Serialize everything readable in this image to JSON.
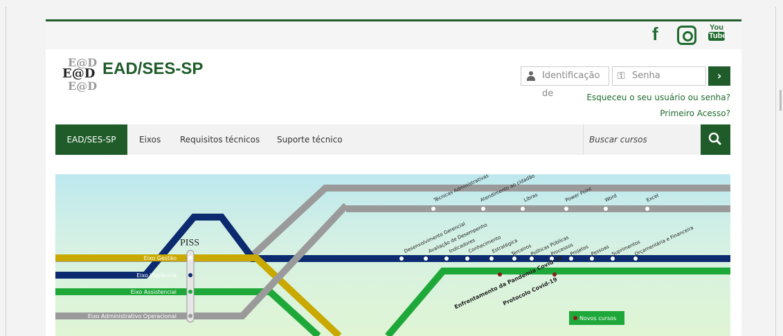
{
  "social": {
    "facebook": "f",
    "youtube_top": "You",
    "youtube_bottom": "Tube"
  },
  "header": {
    "logo_text": "EAD/SES-SP",
    "logo_mark": "E@D",
    "user_placeholder": "Identificação de",
    "pass_placeholder": "Senha",
    "login_button": "›",
    "forgot_link": "Esqueceu o seu usuário ou senha?",
    "first_access_link": "Primeiro Acesso?"
  },
  "nav": {
    "items": [
      "EAD/SES-SP",
      "Eixos",
      "Requisitos técnicos",
      "Suporte técnico"
    ],
    "search_placeholder": "Buscar cursos"
  },
  "banner": {
    "piss": "PISS",
    "axes": [
      "Eixo Gestão",
      "Eixo Vigilância",
      "Eixo Assistencial",
      "Eixo Administrativo Operacional"
    ],
    "top_line": [
      "Técnicas Administrativas",
      "Atendimento ao cidadão",
      "Libras",
      "Power Point",
      "Word",
      "Excel"
    ],
    "middle_line": [
      "Desenvolvimento Gerencial",
      "Avaliação de Desempenho",
      "Indicadores",
      "Conhecimento",
      "Estratégica",
      "Terceiros",
      "Políticas Públicas",
      "Processos",
      "Projetos",
      "Pessoas",
      "Suprimentos",
      "Orçamentária e Financeira"
    ],
    "green_line": [
      "Enfrentamento da Pandemia Covid-19",
      "Protocolo Covid-19"
    ],
    "new_courses": "Novos cursos",
    "colors": {
      "gold": "#c9a800",
      "navy": "#0b2a6f",
      "green": "#1fa83a",
      "gray": "#9a9a9a"
    }
  }
}
